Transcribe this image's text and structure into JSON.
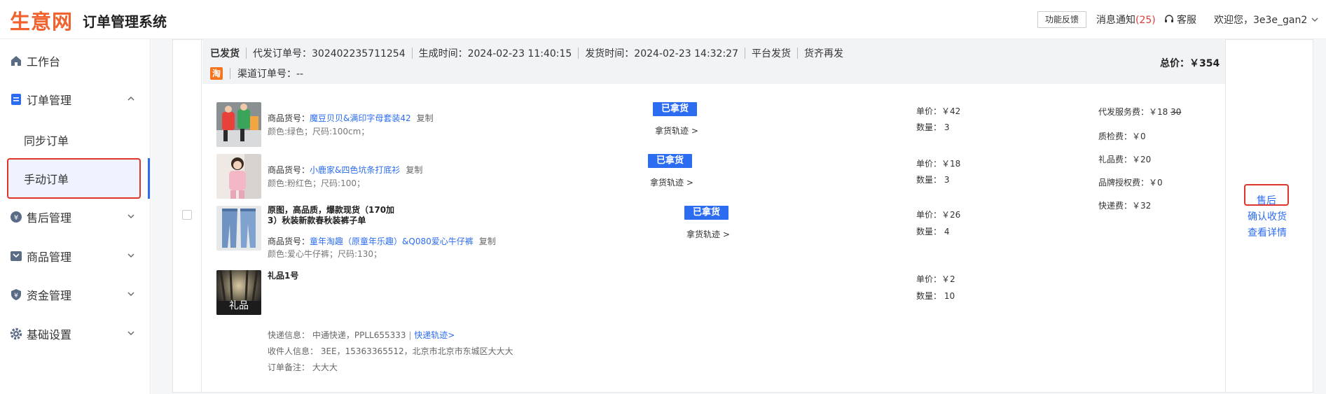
{
  "header": {
    "logo": "生意网",
    "title": "订单管理系统",
    "feedback": "功能反馈",
    "notify_label": "消息通知",
    "notify_count": "(25)",
    "service": "客服",
    "welcome": "欢迎您，3e3e_gan2"
  },
  "sidebar": {
    "items": [
      {
        "label": "工作台",
        "icon": "home-icon"
      },
      {
        "label": "订单管理",
        "icon": "order-icon"
      },
      {
        "label": "同步订单"
      },
      {
        "label": "手动订单"
      },
      {
        "label": "售后管理",
        "icon": "aftersale-icon"
      },
      {
        "label": "商品管理",
        "icon": "goods-icon"
      },
      {
        "label": "资金管理",
        "icon": "fund-icon"
      },
      {
        "label": "基础设置",
        "icon": "settings-icon"
      }
    ]
  },
  "order": {
    "status": "已发货",
    "agent_order_no": "代发订单号：302402235711254",
    "created_at": "生成时间：2024-02-23 11:40:15",
    "shipped_at": "发货时间：2024-02-23 14:32:27",
    "ship_mode": "平台发货",
    "resend": "货齐再发",
    "channel_badge": "淘",
    "channel_order": "渠道订单号：--",
    "total": "总价：￥354",
    "items": [
      {
        "sku_label": "商品货号：",
        "sku": "魔豆贝贝&满印字母套装42",
        "copy": "复制",
        "spec": "颜色:绿色；尺码:100cm；",
        "badge": "已拿货",
        "trace": "拿货轨迹 >",
        "unit_price": "单价：￥42",
        "qty": "数量： 3"
      },
      {
        "sku_label": "商品货号：",
        "sku": "小鹿家&四色坑条打底衫",
        "copy": "复制",
        "spec": "颜色:粉红色；尺码:100；",
        "badge": "已拿货",
        "trace": "拿货轨迹 >",
        "unit_price": "单价：￥18",
        "qty": "数量： 3"
      },
      {
        "title": "原图，高品质，爆款现货（170加3）秋装新款春秋装裤子单",
        "sku_label": "商品货号：",
        "sku": "童年淘趣（原童年乐趣）&Q080爱心牛仔裤",
        "copy": "复制",
        "spec": "颜色:爱心牛仔裤；尺码:130；",
        "badge": "已拿货",
        "trace": "拿货轨迹 >",
        "unit_price": "单价：￥26",
        "qty": "数量： 4"
      },
      {
        "title": "礼品1号",
        "thumb_text": "礼品",
        "unit_price": "单价：￥2",
        "qty": "数量： 10"
      }
    ],
    "fees": {
      "service": "代发服务费：￥18",
      "service_old": "30",
      "qc": "质检费：￥0",
      "gift": "礼品费：￥20",
      "brand": "品牌授权费：￥0",
      "express": "快递费：￥32"
    },
    "delivery": {
      "express_label": "快递信息：",
      "express_val": "中通快递，PPLL655333",
      "express_link": "快递轨迹>",
      "receiver_label": "收件人信息：",
      "receiver_val": "3EE，15363365512，北京市北京市东城区大大大",
      "note_label": "订单备注：",
      "note_val": "大大大"
    },
    "actions": {
      "aftersale": "售后",
      "confirm": "确认收货",
      "detail": "查看详情"
    }
  }
}
